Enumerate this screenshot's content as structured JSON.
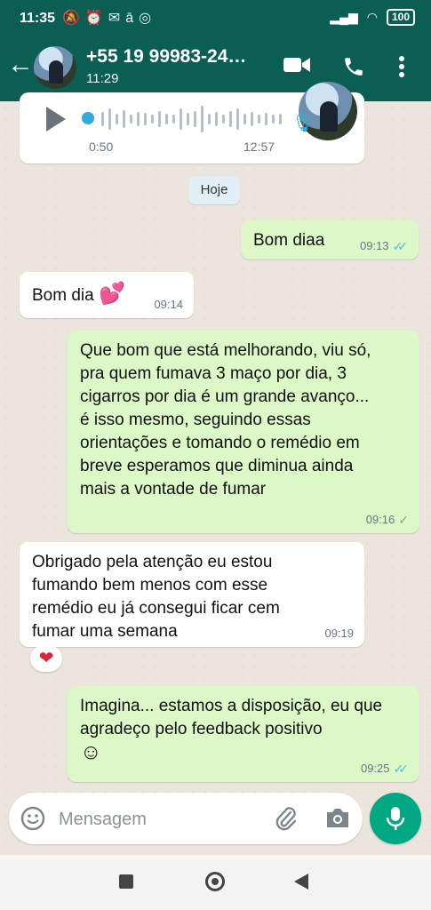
{
  "status_bar": {
    "time": "11:35",
    "battery": "100"
  },
  "header": {
    "contact_name": "+55 19 99983-24…",
    "last_seen": "11:29"
  },
  "audio_message": {
    "duration": "0:50",
    "time": "12:57"
  },
  "date_chip": "Hoje",
  "messages": [
    {
      "direction": "out",
      "text": "Bom diaa",
      "time": "09:13",
      "read": true
    },
    {
      "direction": "in",
      "text": "Bom dia",
      "emoji": "💕",
      "time": "09:14"
    },
    {
      "direction": "out",
      "text": "Que bom que está melhorando, viu só, pra quem fumava 3 maço por dia, 3 cigarros por dia é um grande avanço... é isso mesmo, seguindo essas orientações e tomando o remédio em breve esperamos que diminua ainda mais a vontade de fumar",
      "time": "09:16",
      "read": false
    },
    {
      "direction": "in",
      "text": "Obrigado pela atenção eu estou fumando bem menos com esse remédio eu já consegui ficar cem fumar uma semana",
      "time": "09:19",
      "reaction": "❤"
    },
    {
      "direction": "out",
      "text": "Imagina... estamos a disposição, eu que agradeço pelo feedback positivo",
      "emoji": "☺",
      "time": "09:25",
      "read": true
    }
  ],
  "composer": {
    "placeholder": "Mensagem"
  },
  "colors": {
    "header": "#0b5e54",
    "outgoing_bubble": "#dcf8c6",
    "incoming_bubble": "#ffffff",
    "read_ticks": "#4fb6ec",
    "mic_button": "#00a884"
  },
  "icons": [
    "back-arrow-icon",
    "video-call-icon",
    "phone-icon",
    "more-vert-icon",
    "play-icon",
    "mic-icon",
    "emoji-icon",
    "attach-icon",
    "camera-icon"
  ]
}
